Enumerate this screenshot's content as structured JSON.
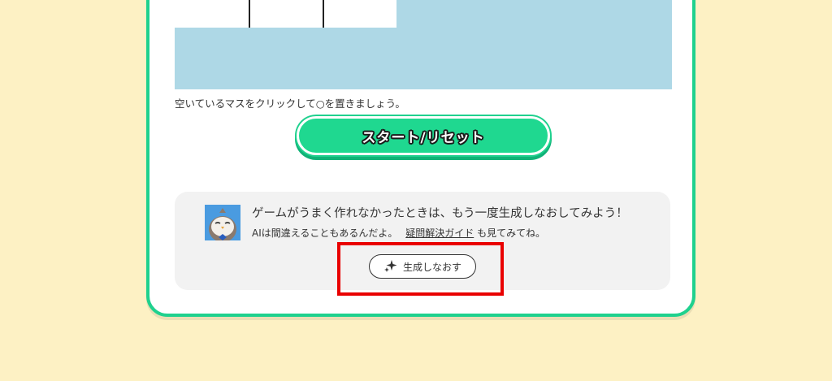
{
  "instruction": "空いているマスをクリックして○を置きましょう。",
  "start_button": {
    "label": "スタート/リセット"
  },
  "hint": {
    "title": "ゲームがうまく作れなかったときは、もう一度生成しなおしてみよう！",
    "subtitle_prefix": "AIは間違えることもあるんだよ。",
    "guide_link": "疑問解決ガイド",
    "subtitle_suffix": "も見てみてね。",
    "regenerate_label": "生成しなおす",
    "avatar_icon": "owl-avatar-icon",
    "regenerate_icon": "sparkle-icon"
  },
  "colors": {
    "page_bg": "#fdf1c4",
    "card_border": "#1fd18e",
    "game_bg": "#aed8e6",
    "start_button_bg": "#1fd890",
    "hint_bg": "#f2f2f2",
    "highlight": "#e90000"
  }
}
